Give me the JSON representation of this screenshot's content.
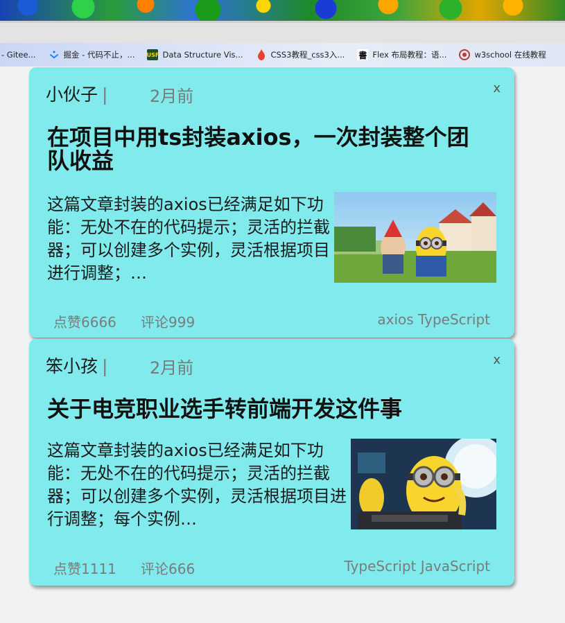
{
  "browser": {
    "bookmarks": [
      {
        "icon": "gitee-icon",
        "label": "- Gitee..."
      },
      {
        "icon": "juejin-icon",
        "label": "掘金 - 代码不止，..."
      },
      {
        "icon": "usf-icon",
        "label": "Data Structure Vis..."
      },
      {
        "icon": "flame-icon",
        "label": "CSS3教程_css3入..."
      },
      {
        "icon": "character-icon",
        "label": "Flex 布局教程：语..."
      },
      {
        "icon": "w3school-icon",
        "label": "w3school 在线教程"
      }
    ]
  },
  "cards": [
    {
      "author": "小伙子",
      "separator": "|",
      "time": "2月前",
      "close": "x",
      "title": "在项目中用ts封装axios，一次封装整个团队收益",
      "description": "这篇文章封装的axios已经满足如下功能：无处不在的代码提示；灵活的拦截器；可以创建多个实例，灵活根据项目进行调整；…",
      "likes": "点赞6666",
      "comments": "评论999",
      "tags": "axios TypeScript"
    },
    {
      "author": "笨小孩",
      "separator": "|",
      "time": "2月前",
      "close": "x",
      "title": "关于电竞职业选手转前端开发这件事",
      "description": "这篇文章封装的axios已经满足如下功能：无处不在的代码提示；灵活的拦截器；可以创建多个实例，灵活根据项目进行调整；每个实例…",
      "likes": "点赞1111",
      "comments": "评论666",
      "tags": "TypeScript JavaScript"
    }
  ]
}
